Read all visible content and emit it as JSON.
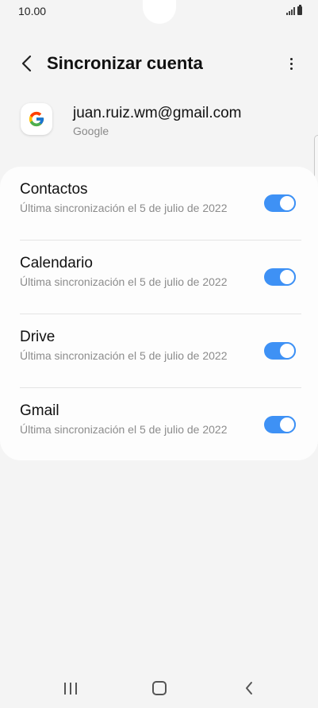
{
  "status_bar": {
    "time": "10.00"
  },
  "app_bar": {
    "title": "Sincronizar cuenta"
  },
  "account": {
    "email": "juan.ruiz.wm@gmail.com",
    "type": "Google"
  },
  "sync_items": [
    {
      "title": "Contactos",
      "subtitle": "Última sincronización el 5 de julio de 2022",
      "enabled": true
    },
    {
      "title": "Calendario",
      "subtitle": "Última sincronización el 5 de julio de 2022",
      "enabled": true
    },
    {
      "title": "Drive",
      "subtitle": "Última sincronización el 5 de julio de 2022",
      "enabled": true
    },
    {
      "title": "Gmail",
      "subtitle": "Última sincronización el 5 de julio de 2022",
      "enabled": true
    }
  ],
  "icons": {
    "back": "back-arrow-icon",
    "more": "more-vert-icon",
    "google": "google-icon",
    "signal": "signal-icon",
    "battery": "battery-icon",
    "recents": "recents-icon",
    "home": "home-icon",
    "nav_back": "nav-back-icon"
  },
  "colors": {
    "accent": "#3e91f5",
    "background": "#f4f4f4",
    "card": "#fdfdfd"
  }
}
